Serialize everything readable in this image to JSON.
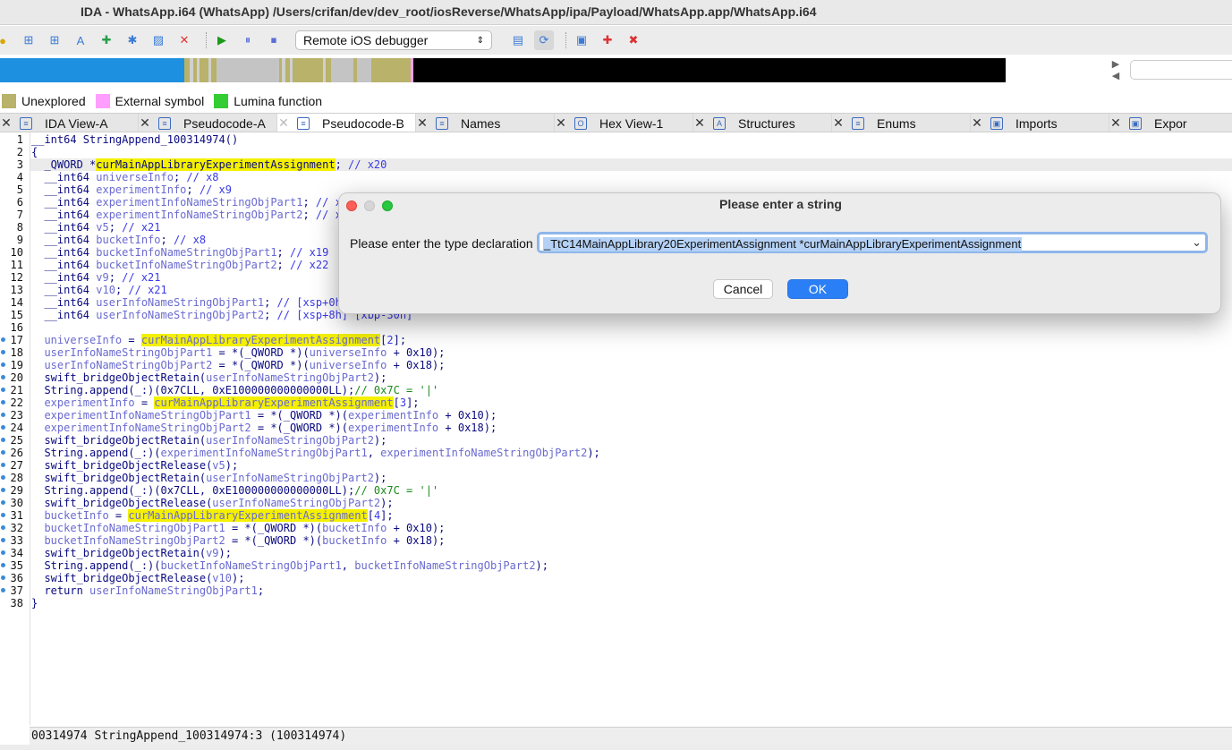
{
  "window": {
    "title": "IDA - WhatsApp.i64 (WhatsApp) /Users/crifan/dev/dev_root/iosReverse/WhatsApp/ipa/Payload/WhatsApp.app/WhatsApp.i64"
  },
  "toolbar": {
    "debugger_select": "Remote iOS debugger"
  },
  "legend": {
    "items": [
      {
        "label": "Unexplored",
        "color": "#bdb76b"
      },
      {
        "label": "External symbol",
        "color": "#ff9eff"
      },
      {
        "label": "Lumina function",
        "color": "#33cc33"
      }
    ]
  },
  "tabs": [
    {
      "label": "IDA View-A",
      "icon": "ida-view-icon"
    },
    {
      "label": "Pseudocode-A",
      "icon": "pseudocode-icon"
    },
    {
      "label": "Pseudocode-B",
      "icon": "pseudocode-icon"
    },
    {
      "label": "Names",
      "icon": "names-icon"
    },
    {
      "label": "Hex View-1",
      "icon": "hex-view-icon"
    },
    {
      "label": "Structures",
      "icon": "structures-icon"
    },
    {
      "label": "Enums",
      "icon": "enums-icon"
    },
    {
      "label": "Imports",
      "icon": "imports-icon"
    },
    {
      "label": "Expor",
      "icon": "exports-icon"
    }
  ],
  "code": {
    "line_numbers": [
      "1",
      "2",
      "3",
      "4",
      "5",
      "6",
      "7",
      "8",
      "9",
      "10",
      "11",
      "12",
      "13",
      "14",
      "15",
      "16",
      "17",
      "18",
      "19",
      "20",
      "21",
      "22",
      "23",
      "24",
      "25",
      "26",
      "27",
      "28",
      "29",
      "30",
      "31",
      "32",
      "33",
      "34",
      "35",
      "36",
      "37",
      "38"
    ],
    "lines": [
      "__int64 StringAppend_100314974()",
      "{",
      "  _QWORD *curMainAppLibraryExperimentAssignment; // x20",
      "  __int64 universeInfo; // x8",
      "  __int64 experimentInfo; // x9",
      "  __int64 experimentInfoNameStringObjPart1; // x",
      "  __int64 experimentInfoNameStringObjPart2; // x",
      "  __int64 v5; // x21",
      "  __int64 bucketInfo; // x8",
      "  __int64 bucketInfoNameStringObjPart1; // x19",
      "  __int64 bucketInfoNameStringObjPart2; // x22",
      "  __int64 v9; // x21",
      "  __int64 v10; // x21",
      "  __int64 userInfoNameStringObjPart1; // [xsp+0h",
      "  __int64 userInfoNameStringObjPart2; // [xsp+8h] [xbp-30h]",
      "",
      "  universeInfo = curMainAppLibraryExperimentAssignment[2];",
      "  userInfoNameStringObjPart1 = *(_QWORD *)(universeInfo + 0x10);",
      "  userInfoNameStringObjPart2 = *(_QWORD *)(universeInfo + 0x18);",
      "  swift_bridgeObjectRetain(userInfoNameStringObjPart2);",
      "  String.append(_:)(0x7CLL, 0xE100000000000000LL);// 0x7C = '|'",
      "  experimentInfo = curMainAppLibraryExperimentAssignment[3];",
      "  experimentInfoNameStringObjPart1 = *(_QWORD *)(experimentInfo + 0x10);",
      "  experimentInfoNameStringObjPart2 = *(_QWORD *)(experimentInfo + 0x18);",
      "  swift_bridgeObjectRetain(userInfoNameStringObjPart2);",
      "  String.append(_:)(experimentInfoNameStringObjPart1, experimentInfoNameStringObjPart2);",
      "  swift_bridgeObjectRelease(v5);",
      "  swift_bridgeObjectRetain(userInfoNameStringObjPart2);",
      "  String.append(_:)(0x7CLL, 0xE100000000000000LL);// 0x7C = '|'",
      "  swift_bridgeObjectRelease(userInfoNameStringObjPart2);",
      "  bucketInfo = curMainAppLibraryExperimentAssignment[4];",
      "  bucketInfoNameStringObjPart1 = *(_QWORD *)(bucketInfo + 0x10);",
      "  bucketInfoNameStringObjPart2 = *(_QWORD *)(bucketInfo + 0x18);",
      "  swift_bridgeObjectRetain(v9);",
      "  String.append(_:)(bucketInfoNameStringObjPart1, bucketInfoNameStringObjPart2);",
      "  swift_bridgeObjectRelease(v10);",
      "  return userInfoNameStringObjPart1;",
      "}"
    ]
  },
  "status": {
    "text": "00314974 StringAppend_100314974:3 (100314974)"
  },
  "dialog": {
    "title": "Please enter a string",
    "label": "Please enter the type declaration",
    "value": "_TtC14MainAppLibrary20ExperimentAssignment *curMainAppLibraryExperimentAssignment",
    "cancel": "Cancel",
    "ok": "OK"
  }
}
